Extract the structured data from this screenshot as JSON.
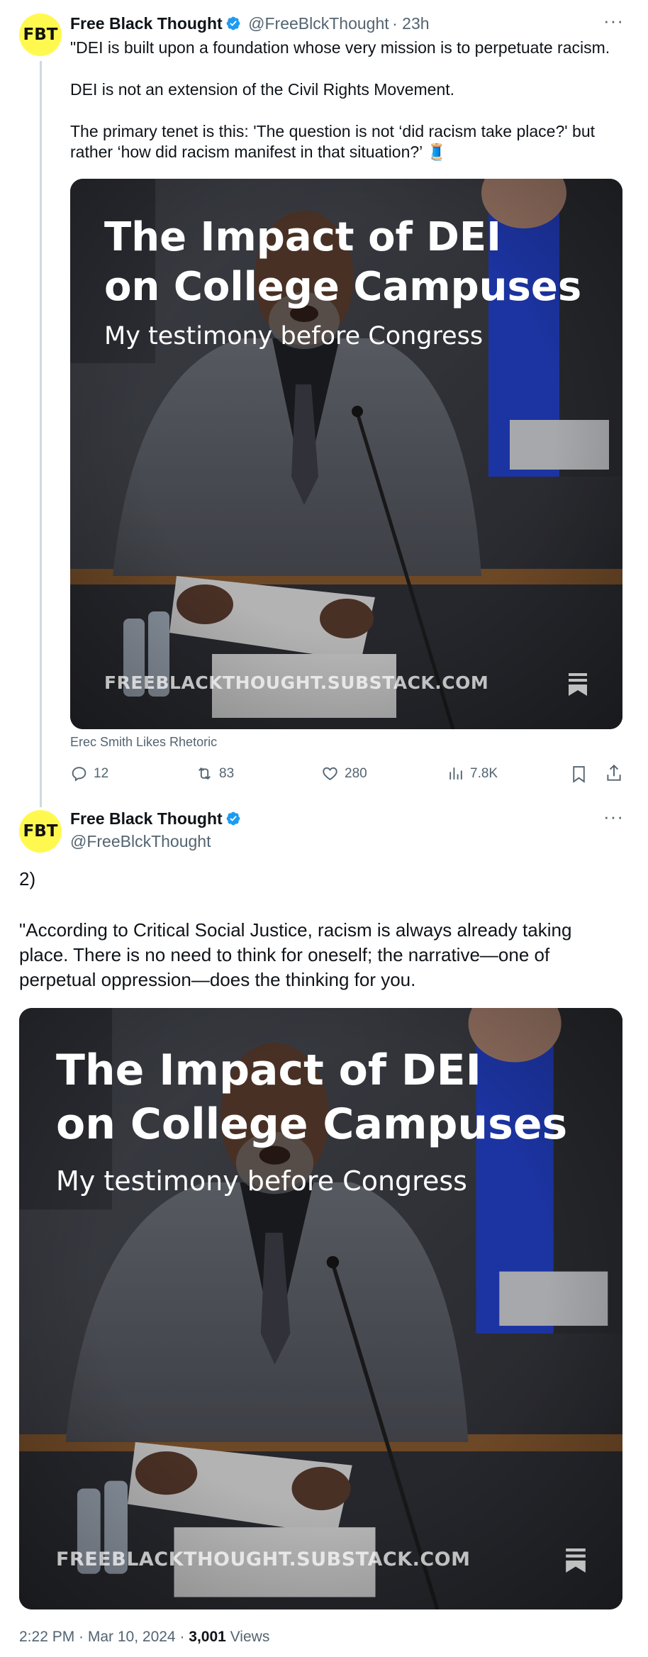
{
  "tweet1": {
    "avatar_text": "FBT",
    "name": "Free Black Thought",
    "handle": "@FreeBlckThought",
    "time": "· 23h",
    "more": "···",
    "lines": [
      "\"DEI is built upon a foundation whose very mission is to perpetuate racism.",
      "DEI is not an extension of the Civil Rights Movement.",
      "The primary tenet is this: 'The question is not ‘did racism take place?' but",
      "rather ‘how did racism manifest in that situation?’ 🧵"
    ],
    "card": {
      "title_line1": "The Impact of DEI",
      "title_line2": "on College Campuses",
      "subtitle": "My testimony before Congress",
      "site": "FREEBLACKTHOUGHT.SUBSTACK.COM",
      "caption": "Erec Smith Likes Rhetoric"
    },
    "actions": {
      "replies": "12",
      "retweets": "83",
      "likes": "280",
      "views": "7.8K"
    }
  },
  "tweet2": {
    "avatar_text": "FBT",
    "name": "Free Black Thought",
    "handle": "@FreeBlckThought",
    "more": "···",
    "number": "2)",
    "lines": [
      "\"According to Critical Social Justice, racism is always already taking",
      "place. There is no need to think for oneself; the narrative—one of",
      "perpetual oppression—does the thinking for you."
    ],
    "card": {
      "title_line1": "The Impact of DEI",
      "title_line2": "on College Campuses",
      "subtitle": "My testimony before Congress",
      "site": "FREEBLACKTHOUGHT.SUBSTACK.COM"
    },
    "footer": {
      "timestamp": "2:22 PM · Mar 10, 2024 · ",
      "views_count": "3,001",
      "views_label": " Views"
    }
  },
  "colors": {
    "avatar_bg": "#fff94f",
    "verified": "#1d9bf0",
    "secondary_text": "#536471",
    "thread_line": "#cfd9de"
  },
  "icons": [
    "verified-badge-icon",
    "reply-icon",
    "retweet-icon",
    "like-icon",
    "views-icon",
    "bookmark-icon",
    "share-icon",
    "substack-bookmark-icon",
    "thread-icon"
  ]
}
